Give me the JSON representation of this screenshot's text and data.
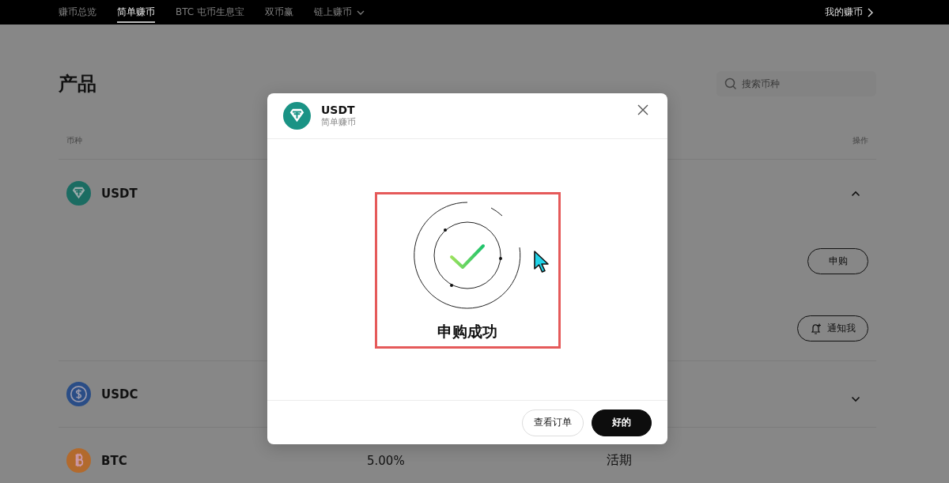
{
  "nav": {
    "items": [
      {
        "label": "赚币总览",
        "selected": false,
        "dropdown": false
      },
      {
        "label": "简单赚币",
        "selected": true,
        "dropdown": false
      },
      {
        "label": "BTC 屯币生息宝",
        "selected": false,
        "dropdown": false
      },
      {
        "label": "双币赢",
        "selected": false,
        "dropdown": false
      },
      {
        "label": "链上赚币",
        "selected": false,
        "dropdown": true
      }
    ],
    "right_link": "我的赚币"
  },
  "page_title": "产品",
  "search": {
    "placeholder": "搜索币种"
  },
  "table": {
    "columns": [
      "币种",
      "操作"
    ],
    "rows": [
      {
        "coin": "USDT",
        "kind": "usdt",
        "expanded": true,
        "actions": [
          {
            "label": "申购",
            "kind": "plain"
          },
          {
            "label": "通知我",
            "kind": "notify"
          }
        ]
      },
      {
        "coin": "USDC",
        "kind": "usdc",
        "expanded": false
      },
      {
        "coin": "BTC",
        "kind": "btc",
        "column_2": "5.00%",
        "column_3": "活期"
      }
    ]
  },
  "modal": {
    "coin": "USDT",
    "kind": "usdt",
    "subtitle": "简单赚币",
    "message": "申购成功",
    "buttons": [
      {
        "label": "查看订单",
        "kind": "secondary"
      },
      {
        "label": "好的",
        "kind": "primary"
      }
    ]
  }
}
